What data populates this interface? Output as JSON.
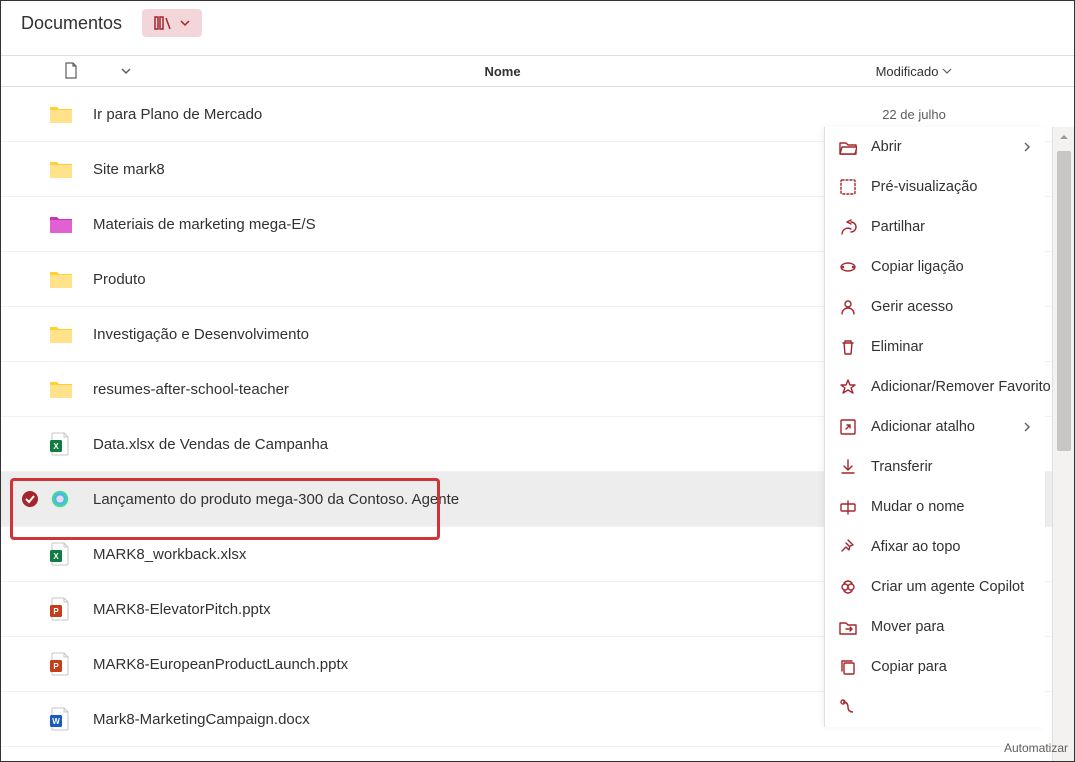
{
  "header": {
    "title": "Documentos"
  },
  "columns": {
    "name": "Nome",
    "modified": "Modificado"
  },
  "rows": [
    {
      "type": "folder",
      "color": "yellow",
      "name": "Ir para Plano de Mercado",
      "modified": "22 de julho"
    },
    {
      "type": "folder",
      "color": "yellow",
      "name": "Site mark8",
      "modified": ""
    },
    {
      "type": "folder",
      "color": "magenta",
      "name": "Materiais de marketing mega-E/S",
      "modified": ""
    },
    {
      "type": "folder",
      "color": "yellow",
      "name": "Produto",
      "modified": ""
    },
    {
      "type": "folder",
      "color": "yellow",
      "name": "Investigação e Desenvolvimento",
      "modified": ""
    },
    {
      "type": "folder",
      "color": "yellow",
      "name": "resumes-after-school-teacher",
      "modified": ""
    },
    {
      "type": "xlsx",
      "name": "Data.xlsx de Vendas de Campanha",
      "modified": ""
    },
    {
      "type": "agent",
      "name": "Lançamento do produto mega-300 da Contoso. Agente",
      "modified": "",
      "selected": true
    },
    {
      "type": "xlsx",
      "name": "MARK8_workback.xlsx",
      "modified": ""
    },
    {
      "type": "pptx",
      "name": "MARK8-ElevatorPitch.pptx",
      "modified": ""
    },
    {
      "type": "pptx",
      "name": "MARK8-EuropeanProductLaunch.pptx",
      "modified": ""
    },
    {
      "type": "docx",
      "name": "Mark8-MarketingCampaign.docx",
      "modified": ""
    }
  ],
  "context_menu": [
    {
      "icon": "open",
      "label": "Abrir",
      "arrow": true
    },
    {
      "icon": "preview",
      "label": "Pré-visualização"
    },
    {
      "icon": "share",
      "label": "Partilhar"
    },
    {
      "icon": "link",
      "label": "Copiar ligação"
    },
    {
      "icon": "access",
      "label": "Gerir acesso"
    },
    {
      "icon": "delete",
      "label": "Eliminar"
    },
    {
      "icon": "favorite",
      "label": "Adicionar/Remover Favorito"
    },
    {
      "icon": "shortcut",
      "label": "Adicionar atalho",
      "arrow": true
    },
    {
      "icon": "download",
      "label": "Transferir"
    },
    {
      "icon": "rename",
      "label": "Mudar o nome"
    },
    {
      "icon": "pin",
      "label": "Afixar ao topo"
    },
    {
      "icon": "copilot",
      "label": "Criar um agente Copilot"
    },
    {
      "icon": "moveto",
      "label": "Mover para"
    },
    {
      "icon": "copyto",
      "label": "Copiar para"
    }
  ],
  "footer": {
    "automate": "Automatizar"
  }
}
